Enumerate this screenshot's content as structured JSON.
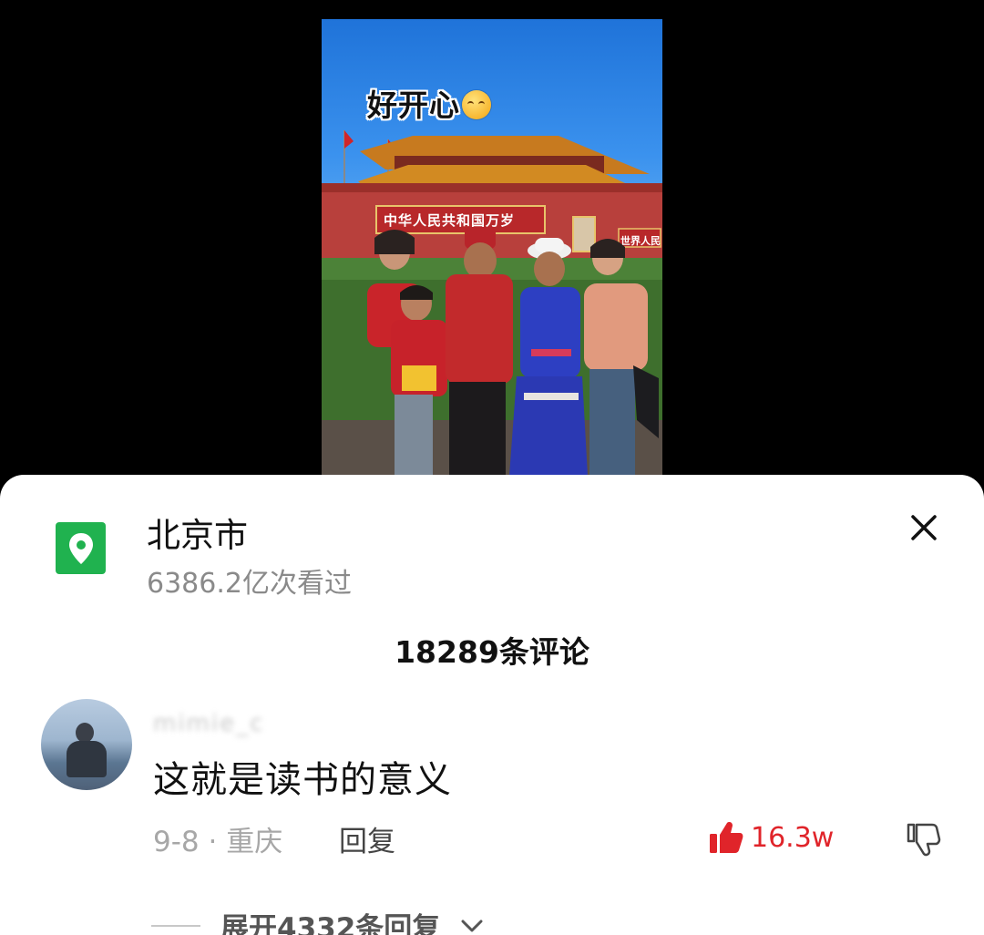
{
  "video": {
    "overlay_caption": "好开心",
    "emoji_icon": "relieved-face-emoji-icon",
    "banner_left": "中华人民共和国万岁",
    "banner_right": "世界人民"
  },
  "location_sheet": {
    "icon": "location-pin-icon",
    "icon_color": "#20b24f",
    "title": "北京市",
    "views": "6386.2亿次看过",
    "close_icon": "close-icon"
  },
  "comments": {
    "count_label": "18289条评论",
    "items": [
      {
        "username": "mimie_c",
        "text": "这就是读书的意义",
        "meta": "9-8 · 重庆",
        "reply_label": "回复",
        "like_count": "16.3w",
        "like_color": "#e0242a",
        "expand_label": "展开4332条回复"
      }
    ]
  }
}
